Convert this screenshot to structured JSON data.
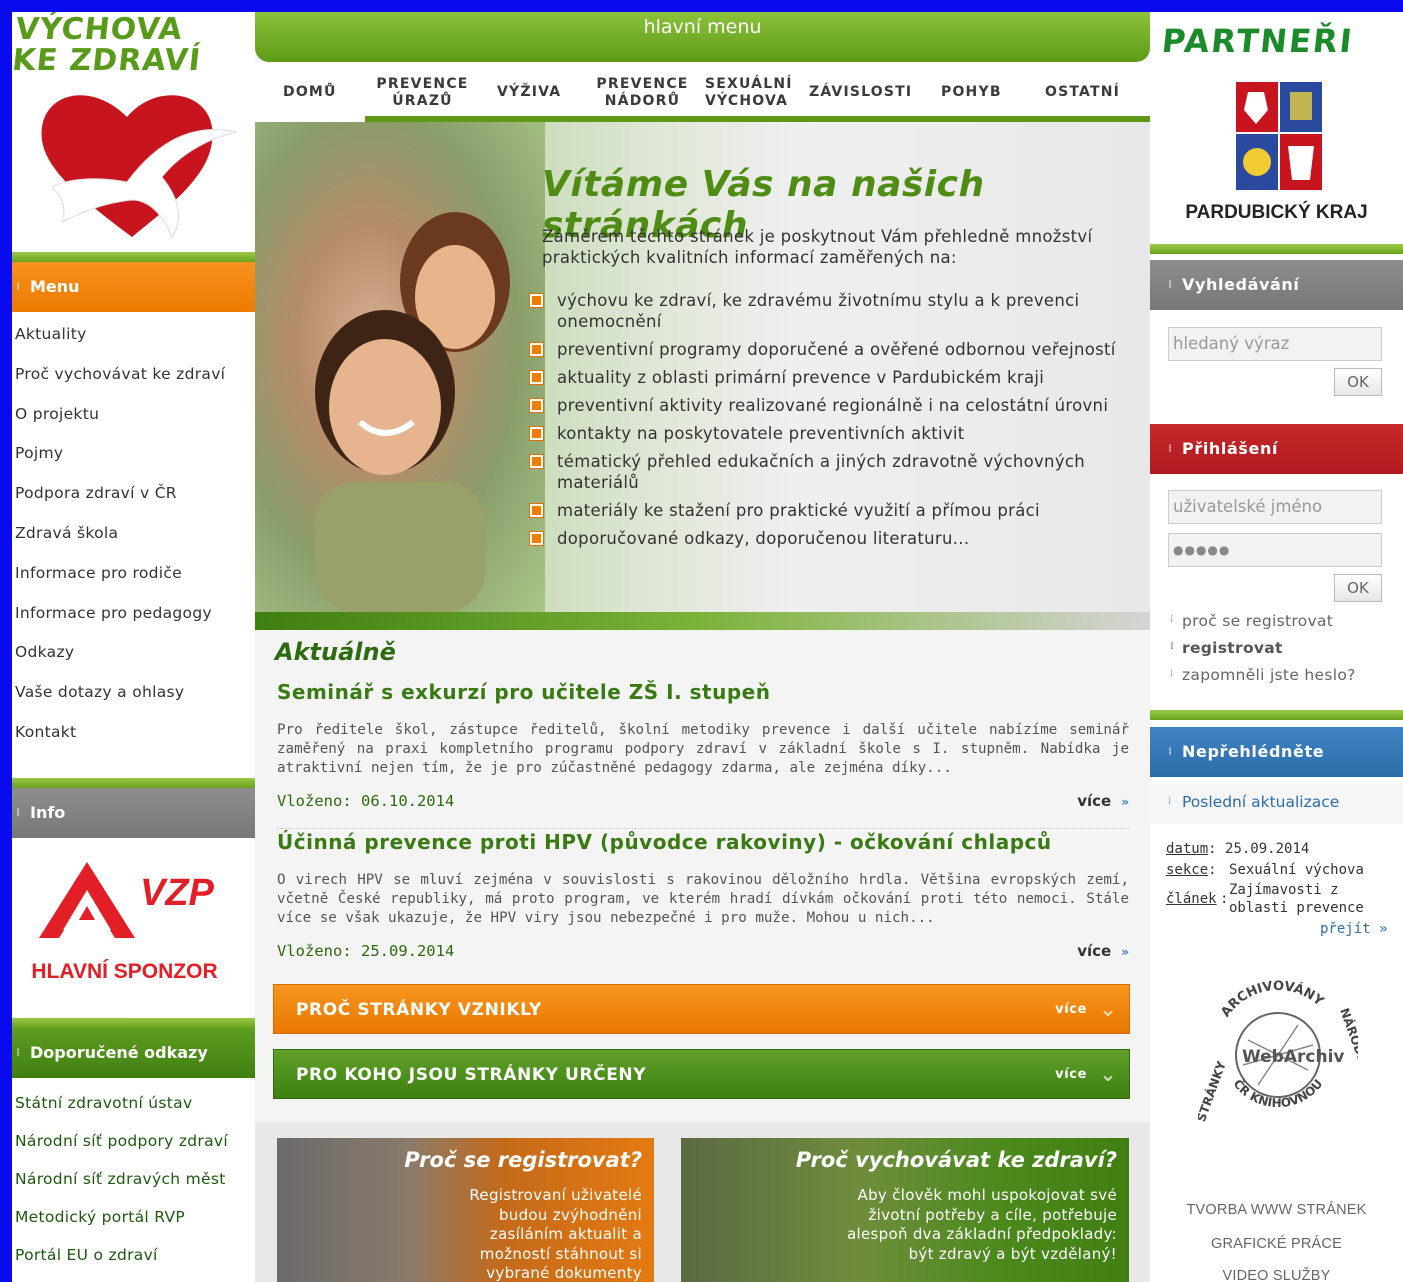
{
  "logo": {
    "line1": "VÝCHOVA",
    "line2": "KE ZDRAVÍ"
  },
  "left_menu": {
    "heading": "Menu",
    "items": [
      "Aktuality",
      "Proč vychovávat ke zdraví",
      "O projektu",
      "Pojmy",
      "Podpora zdraví v ČR",
      "Zdravá škola",
      "Informace pro rodiče",
      "Informace pro pedagogy",
      "Odkazy",
      "Vaše dotazy a ohlasy",
      "Kontakt"
    ]
  },
  "info": {
    "heading": "Info",
    "sponsor_brand": "VZP",
    "sponsor_label": "HLAVNÍ SPONZOR"
  },
  "recommended": {
    "heading": "Doporučené odkazy",
    "items": [
      "Státní zdravotní ústav",
      "Národní síť podpory zdraví",
      "Národní síť zdravých měst",
      "Metodický portál RVP",
      "Portál EU o zdraví"
    ]
  },
  "topnav": {
    "title": "hlavní menu",
    "items": [
      "DOMŮ",
      "PREVENCE ÚRAZŮ",
      "VÝŽIVA",
      "PREVENCE NÁDORŮ",
      "SEXUÁLNÍ VÝCHOVA",
      "ZÁVISLOSTI",
      "POHYB",
      "OSTATNÍ"
    ]
  },
  "hero": {
    "title": "Vítáme Vás na našich stránkách",
    "intro": "Záměrem těchto stránek je poskytnout Vám přehledně množství praktických kvalitních informací zaměřených na:",
    "bullets": [
      "výchovu ke zdraví, ke zdravému životnímu stylu a k prevenci onemocnění",
      "preventivní programy doporučené a ověřené odbornou veřejností",
      "aktuality z oblasti primární prevence v Pardubickém kraji",
      "preventivní aktivity realizované regionálně i na celostátní úrovni",
      "kontakty na poskytovatele preventivních aktivit",
      "tématický přehled edukačních a jiných zdravotně výchovných materiálů",
      "materiály ke stažení pro praktické využití a přímou práci",
      "doporučované odkazy, doporučenou literaturu..."
    ]
  },
  "news": {
    "heading": "Aktuálně",
    "articles": [
      {
        "title": "Seminář s exkurzí pro učitele ZŠ I. stupeň",
        "text": "Pro ředitele škol, zástupce ředitelů, školní metodiky prevence i další učitele nabízíme seminář zaměřený na praxi kompletního programu podpory zdraví v základní škole s I. stupněm. Nabídka je atraktivní nejen tím, že je pro zúčastněné pedagogy zdarma, ale zejména díky...",
        "date": "Vloženo: 06.10.2014",
        "more": "více"
      },
      {
        "title": "Účinná prevence proti HPV (původce rakoviny) - očkování chlapců",
        "text": "O virech HPV se mluví zejména v souvislosti s rakovinou děložního hrdla. Většina evropských zemí, včetně České republiky, má proto program, ve kterém hradí dívkám očkování proti této nemoci. Stále více se však ukazuje, že HPV viry jsou nebezpečné i pro muže. Mohou u nich...",
        "date": "Vloženo: 25.09.2014",
        "more": "více"
      }
    ]
  },
  "bands": [
    {
      "label": "PROČ STRÁNKY VZNIKLY",
      "more": "více",
      "color": "#ef8400"
    },
    {
      "label": "PRO KOHO JSOU STRÁNKY URČENY",
      "more": "více",
      "color": "#4b8f1a"
    }
  ],
  "promos": [
    {
      "title": "Proč se registrovat?",
      "text": "Registrovaní uživatelé budou zvýhodněni zasíláním aktualit a možností stáhnout si vybrané dokumenty"
    },
    {
      "title": "Proč vychovávat ke zdraví?",
      "text": "Aby člověk mohl uspokojovat své životní potřeby a cíle, potřebuje alespoň dva základní předpoklady: být zdravý a být vzdělaný!"
    }
  ],
  "partners": {
    "heading": "PARTNEŘI",
    "region": "PARDUBICKÝ KRAJ"
  },
  "search": {
    "heading": "Vyhledávání",
    "placeholder": "hledaný výraz",
    "button": "OK"
  },
  "login": {
    "heading": "Přihlášení",
    "username_placeholder": "uživatelské jméno",
    "password_value": "●●●●●",
    "button": "OK",
    "links": [
      "proč se registrovat",
      "registrovat",
      "zapomněli jste heslo?"
    ]
  },
  "dont_miss": {
    "heading": "Nepřehlédněte",
    "last_update_label": "Poslední aktualizace",
    "date_label": "datum",
    "date_value": "25.09.2014",
    "section_label": "sekce",
    "section_value": "Sexuální výchova",
    "article_label": "článek",
    "article_value_1": "Zajímavosti z",
    "article_value_2": "oblasti prevence",
    "go": "přejít"
  },
  "webarchiv": {
    "top": "ARCHIVOVÁNY",
    "left": "STRÁNKY",
    "right": "NÁRODNÍ",
    "bottom": "ČR KNIHOVNOU",
    "center": "WebArchiv"
  },
  "footer_links": [
    "TVORBA WWW STRÁNEK",
    "GRAFICKÉ PRÁCE",
    "VIDEO SLUŽBY"
  ]
}
